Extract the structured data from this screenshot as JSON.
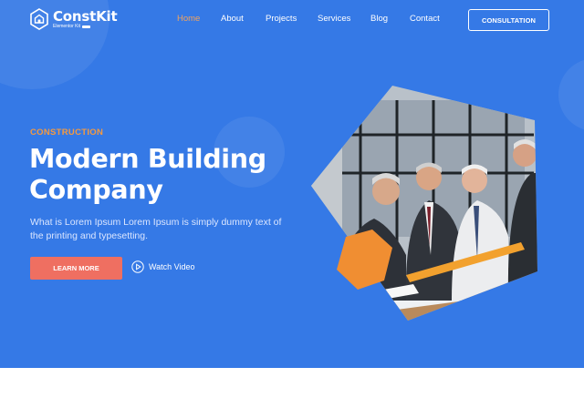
{
  "brand": {
    "name": "ConstKit",
    "tagline": "Elementor Kit"
  },
  "nav": {
    "items": [
      {
        "label": "Home",
        "active": true
      },
      {
        "label": "About",
        "active": false
      },
      {
        "label": "Projects",
        "active": false
      },
      {
        "label": "Services",
        "active": false
      },
      {
        "label": "Blog",
        "active": false
      },
      {
        "label": "Contact",
        "active": false
      }
    ],
    "cta_label": "CONSULTATION"
  },
  "hero": {
    "eyebrow": "CONSTRUCTION",
    "title_line1": "Modern Building",
    "title_line2": "Company",
    "description": "What is Lorem Ipsum Lorem Ipsum is simply dummy text of the printing and typesetting.",
    "primary_button": "LEARN MORE",
    "secondary_button": "Watch Video",
    "image_icon": "meeting-photo"
  },
  "colors": {
    "background": "#3579e6",
    "accent_orange": "#f59a40",
    "button_coral": "#ef6f61",
    "active_nav": "#f2a35e"
  }
}
